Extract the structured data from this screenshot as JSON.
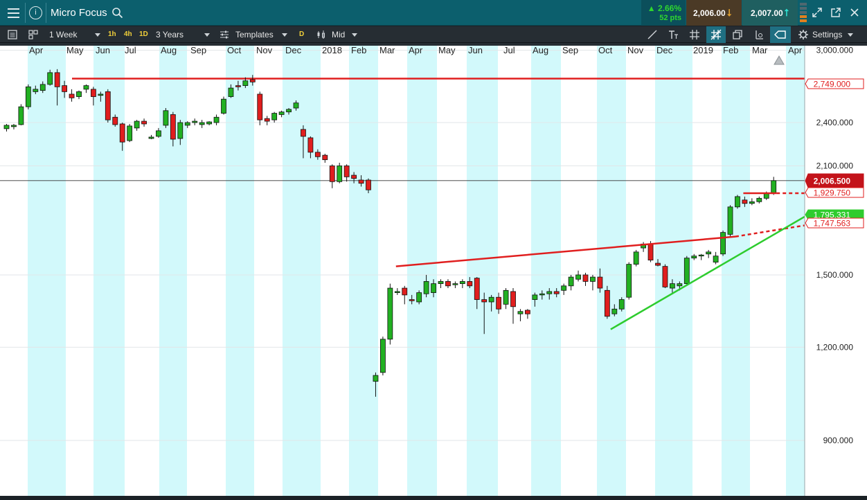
{
  "window": {
    "title": "Micro Focus",
    "change_pct": "▲ 2.66%",
    "change_pts": "52 pts",
    "sell_price": "2,006.00",
    "buy_price": "2,007.00",
    "icons": [
      "menu-icon",
      "info-icon",
      "search-icon",
      "expand-icon",
      "popout-icon",
      "close-icon"
    ]
  },
  "toolbar": {
    "interval": "1 Week",
    "quick_intervals": [
      "1h",
      "4h",
      "1D"
    ],
    "range": "3 Years",
    "templates_label": "Templates",
    "d_label": "D",
    "price_type": "Mid",
    "settings_label": "Settings"
  },
  "colors": {
    "up": "#22b022",
    "down": "#e01e1e",
    "band": "#d2f9fb",
    "resistance": "#e01e1e",
    "support": "#2ecc2e",
    "current_tag": "#c3131a"
  },
  "chart_data": {
    "type": "candlestick",
    "interval": "1 Week",
    "range": "3 Years",
    "y_scale": "log",
    "y_ticks": [
      "3,000.000",
      "2,400.000",
      "2,100.000",
      "1,500.000",
      "1,200.000",
      "900.000"
    ],
    "y_tick_values": [
      3000,
      2400,
      2100,
      1500,
      1200,
      900
    ],
    "x_labels": [
      "Apr",
      "May",
      "Jun",
      "Jul",
      "Aug",
      "Sep",
      "Oct",
      "Nov",
      "Dec",
      "2018",
      "Feb",
      "Mar",
      "Apr",
      "May",
      "Jun",
      "Jul",
      "Aug",
      "Sep",
      "Oct",
      "Nov",
      "Dec",
      "2019",
      "Feb",
      "Mar",
      "Apr"
    ],
    "price_tags": [
      {
        "label": "2,749.000",
        "value": 2749,
        "style": "outline-red"
      },
      {
        "label": "2,006.500",
        "value": 2006.5,
        "style": "current"
      },
      {
        "label": "1,929.750",
        "value": 1929.75,
        "style": "outline-red"
      },
      {
        "label": "1,795.331",
        "value": 1795.331,
        "style": "green"
      },
      {
        "label": "1,747.563",
        "value": 1747.563,
        "style": "outline-red"
      }
    ],
    "horizontal_lines": [
      {
        "name": "resistance-2749",
        "value": 2749
      },
      {
        "name": "current-price",
        "value": 2006.5
      }
    ],
    "candles": [
      [
        2355,
        2390,
        2335,
        2380
      ],
      [
        2370,
        2390,
        2350,
        2380
      ],
      [
        2385,
        2540,
        2380,
        2520
      ],
      [
        2520,
        2700,
        2500,
        2680
      ],
      [
        2640,
        2690,
        2620,
        2660
      ],
      [
        2650,
        2725,
        2630,
        2700
      ],
      [
        2700,
        2825,
        2690,
        2800
      ],
      [
        2800,
        2830,
        2530,
        2680
      ],
      [
        2690,
        2730,
        2590,
        2640
      ],
      [
        2620,
        2660,
        2560,
        2590
      ],
      [
        2600,
        2650,
        2580,
        2640
      ],
      [
        2660,
        2700,
        2630,
        2690
      ],
      [
        2660,
        2680,
        2530,
        2600
      ],
      [
        2610,
        2640,
        2560,
        2620
      ],
      [
        2640,
        2660,
        2400,
        2420
      ],
      [
        2440,
        2460,
        2370,
        2385
      ],
      [
        2390,
        2400,
        2200,
        2260
      ],
      [
        2270,
        2390,
        2260,
        2375
      ],
      [
        2360,
        2420,
        2340,
        2410
      ],
      [
        2410,
        2430,
        2370,
        2390
      ],
      [
        2285,
        2310,
        2280,
        2295
      ],
      [
        2300,
        2360,
        2290,
        2340
      ],
      [
        2380,
        2510,
        2360,
        2490
      ],
      [
        2460,
        2480,
        2230,
        2280
      ],
      [
        2285,
        2420,
        2240,
        2400
      ],
      [
        2380,
        2410,
        2360,
        2400
      ],
      [
        2400,
        2430,
        2380,
        2410
      ],
      [
        2385,
        2420,
        2360,
        2400
      ],
      [
        2390,
        2410,
        2380,
        2405
      ],
      [
        2400,
        2460,
        2380,
        2440
      ],
      [
        2470,
        2600,
        2460,
        2580
      ],
      [
        2600,
        2700,
        2590,
        2670
      ],
      [
        2690,
        2730,
        2650,
        2680
      ],
      [
        2690,
        2760,
        2670,
        2730
      ],
      [
        2740,
        2780,
        2690,
        2720
      ],
      [
        2620,
        2640,
        2380,
        2420
      ],
      [
        2430,
        2450,
        2380,
        2410
      ],
      [
        2420,
        2480,
        2400,
        2470
      ],
      [
        2460,
        2490,
        2440,
        2480
      ],
      [
        2480,
        2510,
        2460,
        2500
      ],
      [
        2510,
        2570,
        2490,
        2550
      ],
      [
        2350,
        2380,
        2150,
        2300
      ],
      [
        2290,
        2300,
        2150,
        2190
      ],
      [
        2190,
        2210,
        2140,
        2160
      ],
      [
        2170,
        2180,
        2120,
        2140
      ],
      [
        2100,
        2110,
        1960,
        2000
      ],
      [
        2000,
        2120,
        1990,
        2100
      ],
      [
        2100,
        2110,
        2000,
        2030
      ],
      [
        2040,
        2060,
        1990,
        2020
      ],
      [
        2010,
        2040,
        1970,
        1990
      ],
      [
        2010,
        2020,
        1930,
        1950
      ],
      [
        1080,
        1110,
        1030,
        1100
      ],
      [
        1110,
        1240,
        1100,
        1230
      ],
      [
        1230,
        1460,
        1210,
        1440
      ],
      [
        1420,
        1440,
        1410,
        1425
      ],
      [
        1440,
        1450,
        1370,
        1410
      ],
      [
        1390,
        1410,
        1370,
        1385
      ],
      [
        1380,
        1430,
        1370,
        1420
      ],
      [
        1415,
        1500,
        1400,
        1470
      ],
      [
        1420,
        1480,
        1400,
        1460
      ],
      [
        1460,
        1480,
        1440,
        1470
      ],
      [
        1470,
        1480,
        1440,
        1450
      ],
      [
        1455,
        1470,
        1440,
        1460
      ],
      [
        1460,
        1480,
        1440,
        1470
      ],
      [
        1470,
        1490,
        1440,
        1450
      ],
      [
        1485,
        1490,
        1350,
        1390
      ],
      [
        1390,
        1420,
        1250,
        1380
      ],
      [
        1380,
        1410,
        1340,
        1400
      ],
      [
        1400,
        1420,
        1330,
        1350
      ],
      [
        1370,
        1440,
        1350,
        1430
      ],
      [
        1425,
        1440,
        1290,
        1360
      ],
      [
        1330,
        1350,
        1300,
        1340
      ],
      [
        1345,
        1350,
        1310,
        1330
      ],
      [
        1390,
        1420,
        1360,
        1410
      ],
      [
        1410,
        1430,
        1390,
        1415
      ],
      [
        1415,
        1440,
        1390,
        1425
      ],
      [
        1425,
        1440,
        1400,
        1415
      ],
      [
        1430,
        1460,
        1410,
        1450
      ],
      [
        1450,
        1500,
        1430,
        1490
      ],
      [
        1480,
        1520,
        1470,
        1500
      ],
      [
        1500,
        1510,
        1450,
        1470
      ],
      [
        1470,
        1500,
        1430,
        1490
      ],
      [
        1490,
        1530,
        1420,
        1440
      ],
      [
        1430,
        1450,
        1310,
        1320
      ],
      [
        1330,
        1370,
        1320,
        1350
      ],
      [
        1350,
        1400,
        1340,
        1390
      ],
      [
        1400,
        1560,
        1390,
        1550
      ],
      [
        1550,
        1620,
        1540,
        1610
      ],
      [
        1630,
        1660,
        1610,
        1650
      ],
      [
        1650,
        1665,
        1560,
        1570
      ],
      [
        1555,
        1575,
        1540,
        1545
      ],
      [
        1540,
        1550,
        1440,
        1445
      ],
      [
        1440,
        1480,
        1420,
        1460
      ],
      [
        1450,
        1470,
        1430,
        1460
      ],
      [
        1460,
        1590,
        1450,
        1580
      ],
      [
        1580,
        1600,
        1570,
        1590
      ],
      [
        1590,
        1600,
        1570,
        1595
      ],
      [
        1600,
        1620,
        1580,
        1610
      ],
      [
        1560,
        1610,
        1550,
        1590
      ],
      [
        1600,
        1720,
        1590,
        1710
      ],
      [
        1700,
        1860,
        1690,
        1850
      ],
      [
        1850,
        1920,
        1840,
        1910
      ],
      [
        1890,
        1910,
        1850,
        1870
      ],
      [
        1870,
        1900,
        1860,
        1880
      ],
      [
        1880,
        1910,
        1870,
        1900
      ],
      [
        1900,
        1940,
        1890,
        1930
      ],
      [
        1930,
        2030,
        1920,
        2006.5
      ]
    ],
    "trendlines": [
      {
        "name": "upper-resistance-trendline",
        "from": [
          54,
          1560
        ],
        "to": [
          101,
          1710
        ],
        "extend_dotted_to": 1747.563
      },
      {
        "name": "green-support-trendline",
        "from": [
          83,
          1290
        ],
        "to": [
          116,
          1795.331
        ]
      },
      {
        "name": "recent-high-line",
        "from": [
          102,
          1929.75
        ],
        "to": [
          106,
          1929.75
        ],
        "extend_dotted_to": 1929.75
      }
    ]
  }
}
